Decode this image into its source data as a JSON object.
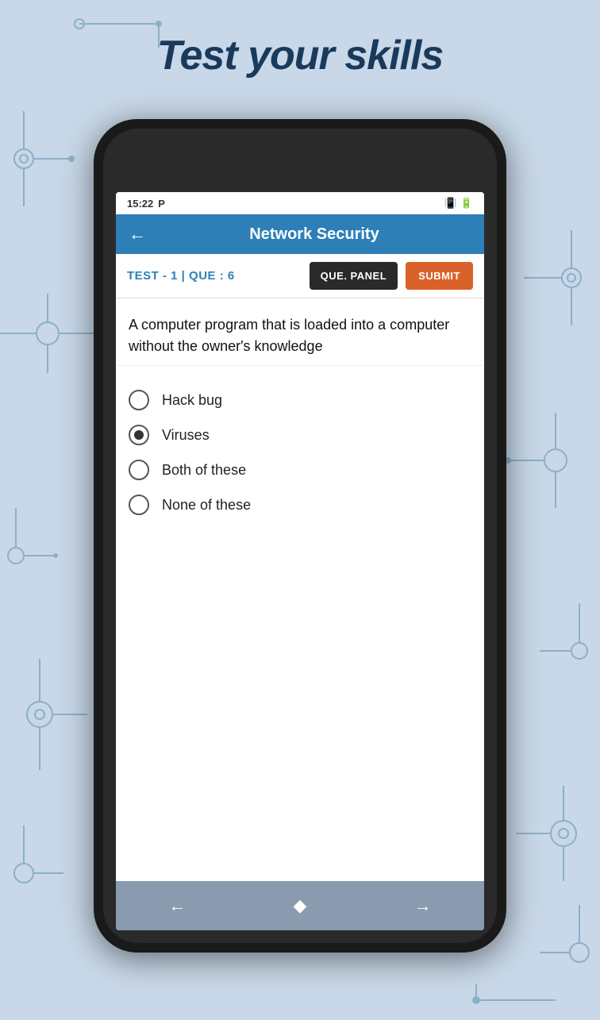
{
  "page": {
    "title": "Test your skills",
    "background_color": "#c8d8e8"
  },
  "status_bar": {
    "time": "15:22",
    "carrier_icon": "P",
    "vibrate_icon": "vibrate",
    "battery_icon": "battery"
  },
  "app_bar": {
    "back_label": "←",
    "title": "Network Security"
  },
  "sub_bar": {
    "test_info": "Test - 1 | Que : 6",
    "que_panel_label": "QUE. PANEL",
    "submit_label": "SUBMIT"
  },
  "question": {
    "text": "A computer program that is loaded into a computer without the owner's knowledge"
  },
  "options": [
    {
      "id": "opt1",
      "label": "Hack bug",
      "selected": false
    },
    {
      "id": "opt2",
      "label": "Viruses",
      "selected": true
    },
    {
      "id": "opt3",
      "label": "Both of these",
      "selected": false
    },
    {
      "id": "opt4",
      "label": "None of these",
      "selected": false
    }
  ],
  "bottom_nav": {
    "prev_label": "←",
    "clear_label": "◆",
    "next_label": "→"
  }
}
